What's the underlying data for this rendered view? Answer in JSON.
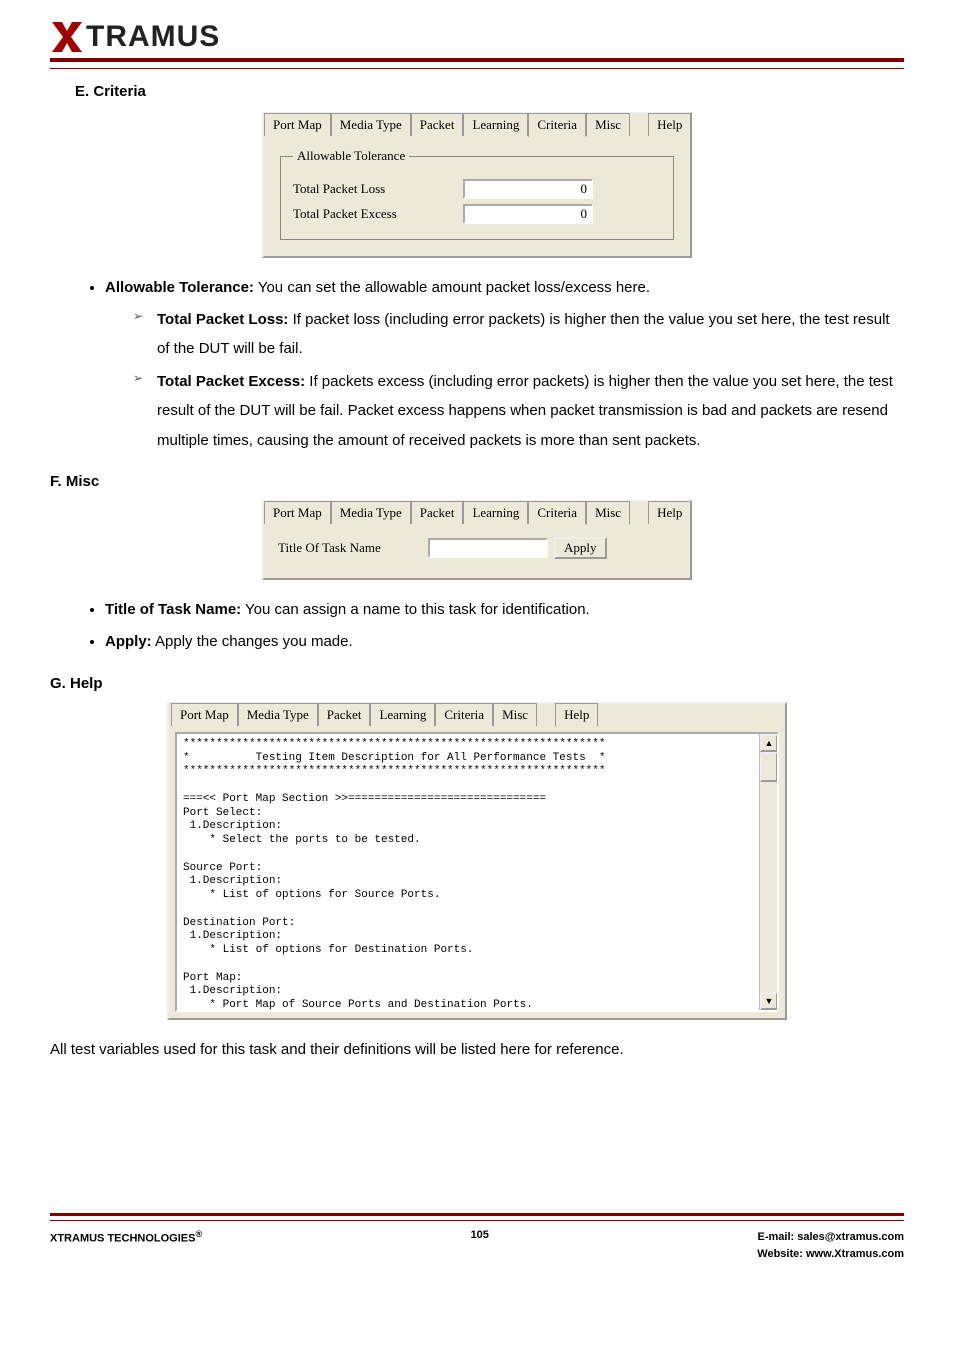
{
  "logo": {
    "text": "TRAMUS"
  },
  "sections": {
    "E": {
      "title": "E. Criteria",
      "tabs": [
        "Port Map",
        "Media Type",
        "Packet",
        "Learning",
        "Criteria",
        "Misc",
        "Help"
      ],
      "active_tab": "Criteria",
      "fieldset_legend": "Allowable Tolerance",
      "rows": {
        "loss": {
          "label": "Total Packet Loss",
          "value": "0"
        },
        "excess": {
          "label": "Total Packet Excess",
          "value": "0"
        }
      },
      "bullets": {
        "b1_bold": "Allowable Tolerance:",
        "b1_rest": " You can set the allowable amount packet loss/excess here.",
        "b1a_bold": "Total Packet Loss:",
        "b1a_rest": " If packet loss (including error packets) is higher then the value you set here, the test result of the DUT will be fail.",
        "b1b_bold": "Total Packet Excess:",
        "b1b_rest": " If packets excess (including error packets) is higher then the value you set here, the test result of the DUT will be fail. Packet excess happens when packet transmission is bad and packets are resend multiple times, causing the amount of received packets is more than sent packets."
      }
    },
    "F": {
      "title": "F. Misc",
      "tabs": [
        "Port Map",
        "Media Type",
        "Packet",
        "Learning",
        "Criteria",
        "Misc",
        "Help"
      ],
      "active_tab": "Misc",
      "row_label": "Title Of Task Name",
      "row_value": "",
      "apply_label": "Apply",
      "bullets": {
        "b1_bold": "Title of Task Name:",
        "b1_rest": " You can assign a name to this task for identification.",
        "b2_bold": "Apply:",
        "b2_rest": " Apply the changes you made."
      }
    },
    "G": {
      "title": "G. Help",
      "tabs": [
        "Port Map",
        "Media Type",
        "Packet",
        "Learning",
        "Criteria",
        "Misc",
        "Help"
      ],
      "active_tab": "Help",
      "help_text": "****************************************************************\n*          Testing Item Description for All Performance Tests  *\n****************************************************************\n\n===<< Port Map Section >>==============================\nPort Select:\n 1.Description:\n    * Select the ports to be tested.\n\nSource Port:\n 1.Description:\n    * List of options for Source Ports.\n\nDestination Port:\n 1.Description:\n    * List of options for Destination Ports.\n\nPort Map:\n 1.Description:\n    * Port Map of Source Ports and Destination Ports.\n\n--> Button:",
      "after_text": "All test variables used for this task and their definitions will be listed here for reference."
    }
  },
  "footer": {
    "left": "XTRAMUS TECHNOLOGIES",
    "reg": "®",
    "page": "105",
    "email_label": "E-mail: ",
    "email": "sales@xtramus.com",
    "web_label": "Website:  ",
    "web": "www.Xtramus.com"
  }
}
